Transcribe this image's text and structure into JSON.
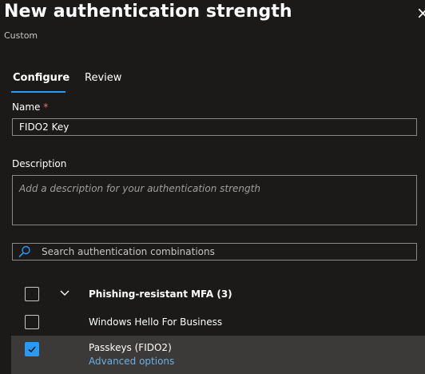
{
  "header": {
    "title": "New authentication strength",
    "subtitle": "Custom"
  },
  "tabs": [
    {
      "label": "Configure",
      "active": true
    },
    {
      "label": "Review",
      "active": false
    }
  ],
  "form": {
    "name_label": "Name",
    "name_required_marker": "*",
    "name_value": "FIDO2 Key",
    "description_label": "Description",
    "description_placeholder": "Add a description for your authentication strength",
    "search_placeholder": "Search authentication combinations"
  },
  "combinations": {
    "group": {
      "label": "Phishing-resistant MFA (3)",
      "checked": false,
      "expanded": true
    },
    "items": [
      {
        "label": "Windows Hello For Business",
        "checked": false
      },
      {
        "label": "Passkeys (FIDO2)",
        "checked": true,
        "link_label": "Advanced options"
      }
    ]
  },
  "colors": {
    "accent": "#2899f5",
    "link": "#69afe5",
    "background": "#1b1a19",
    "selected_row": "#3b3a39",
    "required": "#f1707b"
  },
  "icons": {
    "search": "search-icon",
    "chevron": "chevron-down-icon",
    "check": "checkmark-icon"
  }
}
